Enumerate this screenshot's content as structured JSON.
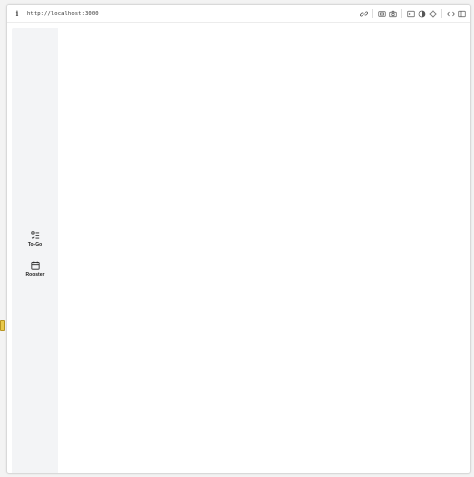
{
  "browser": {
    "info_icon": "info-icon",
    "url": "http://localhost:3000",
    "tools": [
      "link-icon",
      "screenshot-icon",
      "camera-icon",
      "console-icon",
      "dark-mode-icon",
      "crosshair-icon",
      "code-icon",
      "sidebar-toggle-icon"
    ]
  },
  "sidebar": {
    "items": [
      {
        "label": "To-Go",
        "icon": "checklist-icon"
      },
      {
        "label": "Rooster",
        "icon": "calendar-icon"
      }
    ]
  },
  "colors": {
    "sidebar_bg": "#f3f4f6",
    "content_bg": "#ffffff",
    "icon": "#222222"
  }
}
